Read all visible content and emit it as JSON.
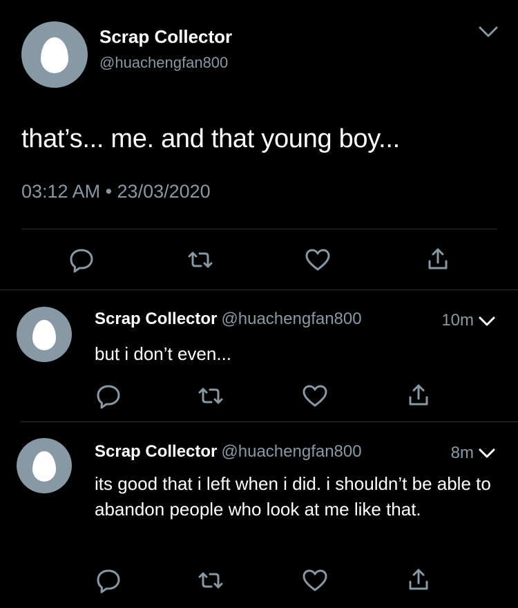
{
  "main_tweet": {
    "display_name": "Scrap Collector",
    "handle": "@huachengfan800",
    "text": "that’s... me. and that young boy...",
    "timestamp": "03:12 AM • 23/03/2020"
  },
  "replies": [
    {
      "display_name": "Scrap Collector",
      "handle": "@huachengfan800",
      "time": "10m",
      "text": "but i don’t even..."
    },
    {
      "display_name": "Scrap Collector",
      "handle": "@huachengfan800",
      "time": "8m",
      "text": "its good that i left when i did. i shouldn’t be able to abandon people who look at me like that."
    }
  ],
  "icons": {
    "reply": "reply-bubble-icon",
    "retweet": "retweet-icon",
    "like": "heart-icon",
    "share": "share-icon",
    "more": "chevron-down-icon"
  },
  "colors": {
    "background": "#000000",
    "text": "#ffffff",
    "secondary_text": "#8899a6",
    "divider": "#2f3336",
    "avatar_bg": "#8899a6"
  }
}
